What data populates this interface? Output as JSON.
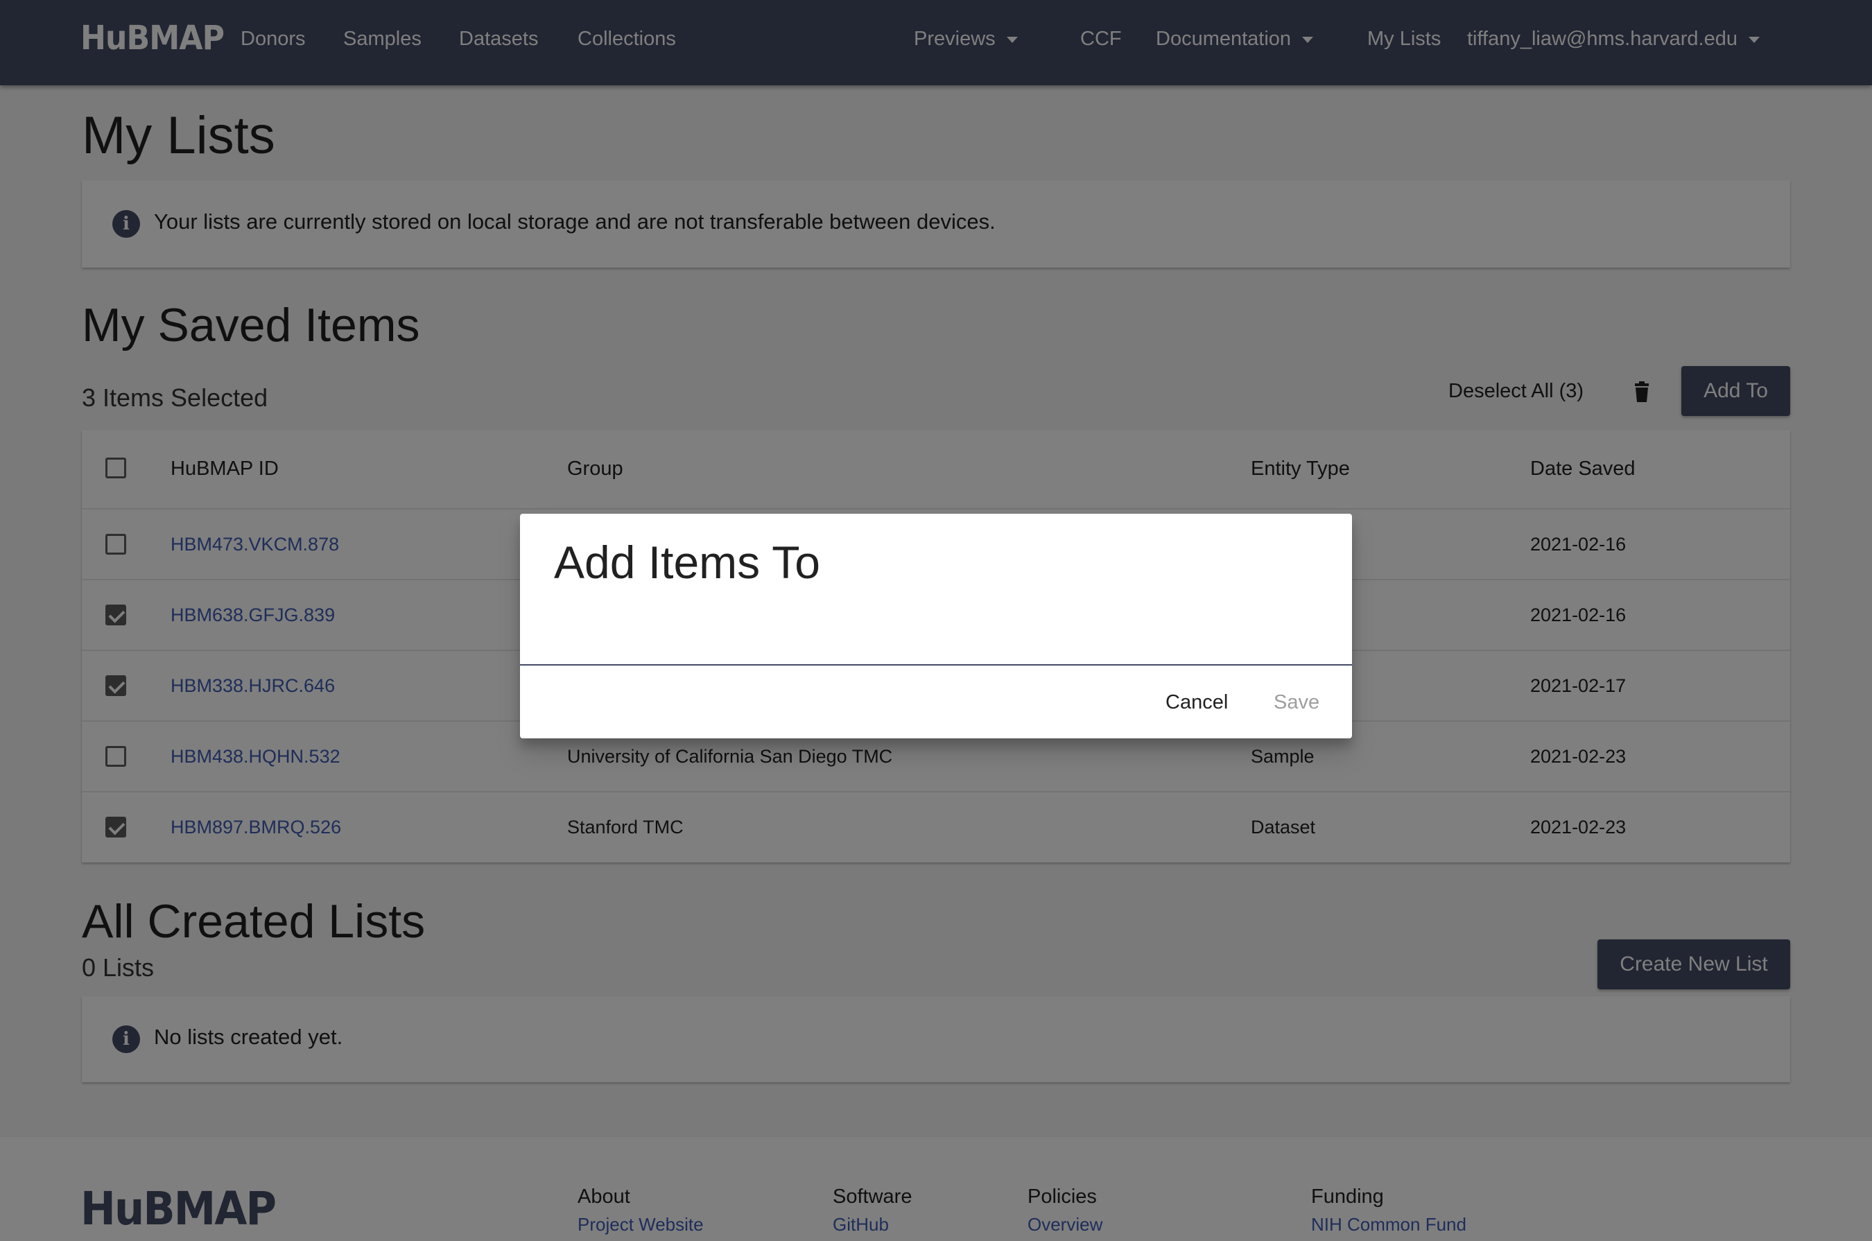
{
  "nav": {
    "logo": "HuBMAP",
    "links": [
      "Donors",
      "Samples",
      "Datasets",
      "Collections"
    ],
    "previews": "Previews",
    "ccf": "CCF",
    "documentation": "Documentation",
    "my_lists": "My Lists",
    "user_email": "tiffany_liaw@hms.harvard.edu"
  },
  "page": {
    "title": "My Lists",
    "storage_notice": "Your lists are currently stored on local storage and are not transferable between devices."
  },
  "saved_items": {
    "title": "My Saved Items",
    "selected_count": "3 Items Selected",
    "deselect_all": "Deselect All (3)",
    "add_to": "Add To",
    "columns": [
      "HuBMAP ID",
      "Group",
      "Entity Type",
      "Date Saved"
    ],
    "rows": [
      {
        "id": "HBM473.VKCM.878",
        "group": "",
        "entity_type": "",
        "date": "2021-02-16",
        "checked": false
      },
      {
        "id": "HBM638.GFJG.839",
        "group": "",
        "entity_type": "",
        "date": "2021-02-16",
        "checked": true
      },
      {
        "id": "HBM338.HJRC.646",
        "group": "",
        "entity_type": "",
        "date": "2021-02-17",
        "checked": true
      },
      {
        "id": "HBM438.HQHN.532",
        "group": "University of California San Diego TMC",
        "entity_type": "Sample",
        "date": "2021-02-23",
        "checked": false
      },
      {
        "id": "HBM897.BMRQ.526",
        "group": "Stanford TMC",
        "entity_type": "Dataset",
        "date": "2021-02-23",
        "checked": true
      }
    ]
  },
  "created_lists": {
    "title": "All Created Lists",
    "count": "0 Lists",
    "create_button": "Create New List",
    "empty_notice": "No lists created yet."
  },
  "footer": {
    "logo": "HuBMAP",
    "columns": [
      {
        "heading": "About",
        "link": "Project Website"
      },
      {
        "heading": "Software",
        "link": "GitHub"
      },
      {
        "heading": "Policies",
        "link": "Overview"
      },
      {
        "heading": "Funding",
        "link": "NIH Common Fund"
      }
    ]
  },
  "dialog": {
    "title": "Add Items To",
    "cancel": "Cancel",
    "save": "Save"
  },
  "colors": {
    "brand": "#444a65",
    "link": "#3e5bb3",
    "overlay": "rgba(0,0,0,0.5)"
  }
}
